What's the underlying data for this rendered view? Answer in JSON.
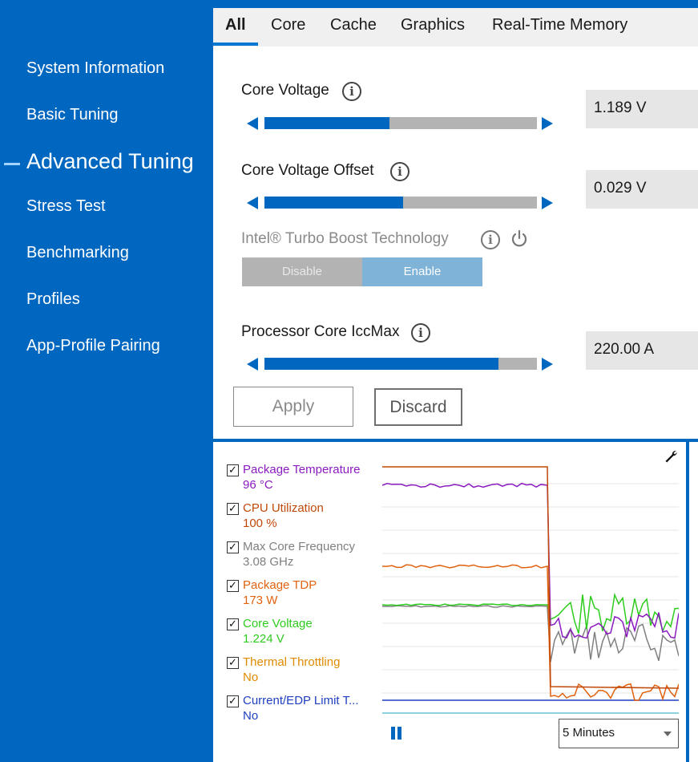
{
  "sidebar": {
    "items": [
      {
        "label": "System Information"
      },
      {
        "label": "Basic Tuning"
      },
      {
        "label": "Advanced Tuning",
        "active": true
      },
      {
        "label": "Stress Test"
      },
      {
        "label": "Benchmarking"
      },
      {
        "label": "Profiles"
      },
      {
        "label": "App-Profile Pairing"
      }
    ]
  },
  "tabs": [
    {
      "label": "All",
      "active": true
    },
    {
      "label": "Core"
    },
    {
      "label": "Cache"
    },
    {
      "label": "Graphics"
    },
    {
      "label": "Real-Time Memory"
    }
  ],
  "settings": {
    "core_voltage": {
      "label": "Core Voltage",
      "value": "1.189 V",
      "slider_level": 0.46
    },
    "core_voltage_offset": {
      "label": "Core Voltage Offset",
      "value": "0.029 V",
      "slider_level": 0.51
    },
    "turbo_boost": {
      "label": "Intel® Turbo Boost Technology",
      "disable_label": "Disable",
      "enable_label": "Enable",
      "selected": "Enable"
    },
    "iccmax": {
      "label": "Processor Core IccMax",
      "value": "220.00 A",
      "slider_level": 0.86
    }
  },
  "actions": {
    "apply_label": "Apply",
    "discard_label": "Discard"
  },
  "monitor": {
    "metrics": [
      {
        "name": "Package Temperature",
        "value": "96 °C",
        "color": "#8b1bbf",
        "checked": true
      },
      {
        "name": "CPU Utilization",
        "value": "100 %",
        "color": "#c0490a",
        "checked": true
      },
      {
        "name": "Max Core Frequency",
        "value": "3.08 GHz",
        "color": "#808080",
        "checked": true
      },
      {
        "name": "Package TDP",
        "value": "173 W",
        "color": "#e0620f",
        "checked": true
      },
      {
        "name": "Core Voltage",
        "value": "1.224 V",
        "color": "#2ecc1e",
        "checked": true
      },
      {
        "name": "Thermal Throttling",
        "value": "No",
        "color": "#e08a00",
        "checked": true
      },
      {
        "name": "Current/EDP Limit T...",
        "value": "No",
        "color": "#1f3fbf",
        "checked": true
      }
    ],
    "time_range": "5 Minutes",
    "icons": {
      "settings": "wrench-icon",
      "pause": "pause-icon"
    }
  },
  "colors": {
    "accent": "#0067c0",
    "panel_bg": "#ffffff",
    "value_bg": "#e6e6e6"
  }
}
